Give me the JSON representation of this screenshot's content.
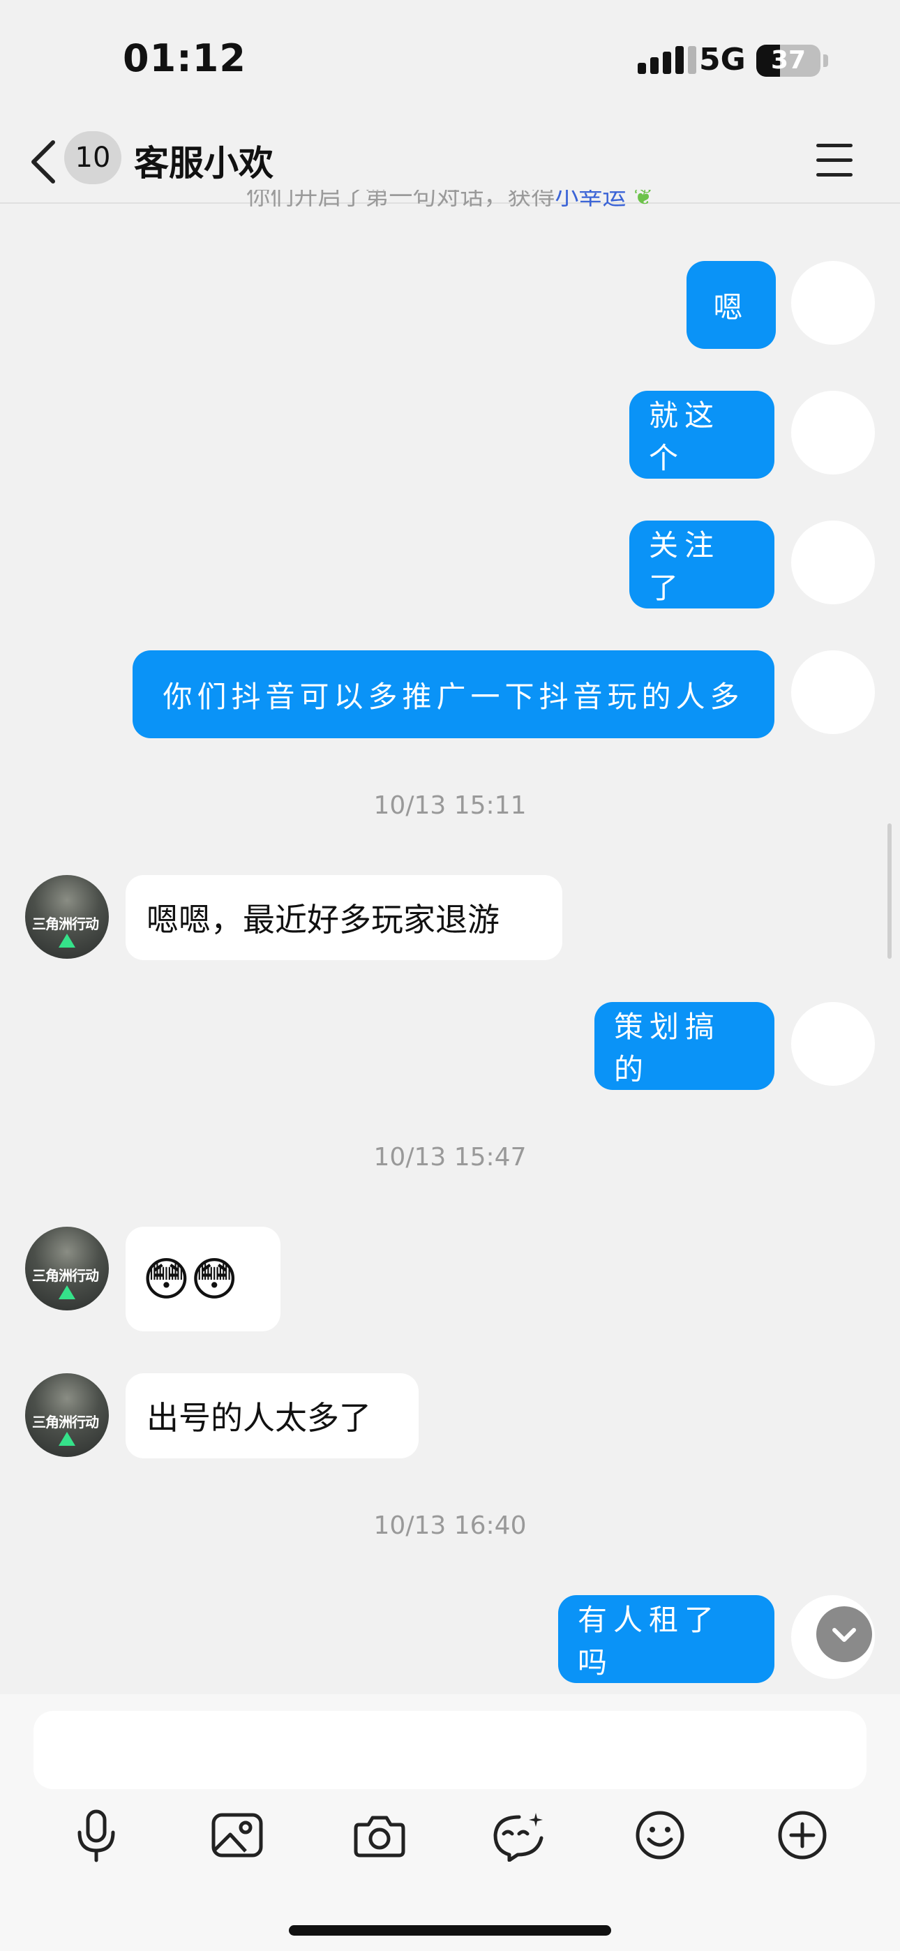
{
  "status_bar": {
    "time": "01:12",
    "network": "5G",
    "battery": "37",
    "battery_level": 0.37
  },
  "header": {
    "unread_count": "10",
    "title": "客服小欢"
  },
  "clipped_notice": {
    "text": "你们开启了第一句对话，获得",
    "highlight": "小幸运"
  },
  "messages": {
    "m1": {
      "text": "嗯",
      "side": "right"
    },
    "m2": {
      "text": "就这个",
      "side": "right"
    },
    "m3": {
      "text": "关注了",
      "side": "right"
    },
    "m4": {
      "text": "你们抖音可以多推广一下抖音玩的人多",
      "side": "right"
    },
    "ts1": {
      "text": "10/13 15:11"
    },
    "m5": {
      "text": "嗯嗯，最近好多玩家退游",
      "side": "left"
    },
    "m6": {
      "text": "策划搞的",
      "side": "right"
    },
    "ts2": {
      "text": "10/13 15:47"
    },
    "m7": {
      "text": "😳😳",
      "side": "left"
    },
    "m8": {
      "text": "出号的人太多了",
      "side": "left"
    },
    "ts3": {
      "text": "10/13 16:40"
    },
    "m9": {
      "text": "有人租了吗",
      "side": "right"
    }
  },
  "agent_avatar": {
    "label": "三角洲行动"
  },
  "toolbar": {
    "icons": [
      "microphone-icon",
      "image-icon",
      "camera-icon",
      "sticker-icon",
      "emoji-icon",
      "plus-icon"
    ]
  },
  "colors": {
    "bubble_self": "#0a93f7",
    "bubble_other": "#ffffff",
    "background": "#f1f1f1"
  }
}
